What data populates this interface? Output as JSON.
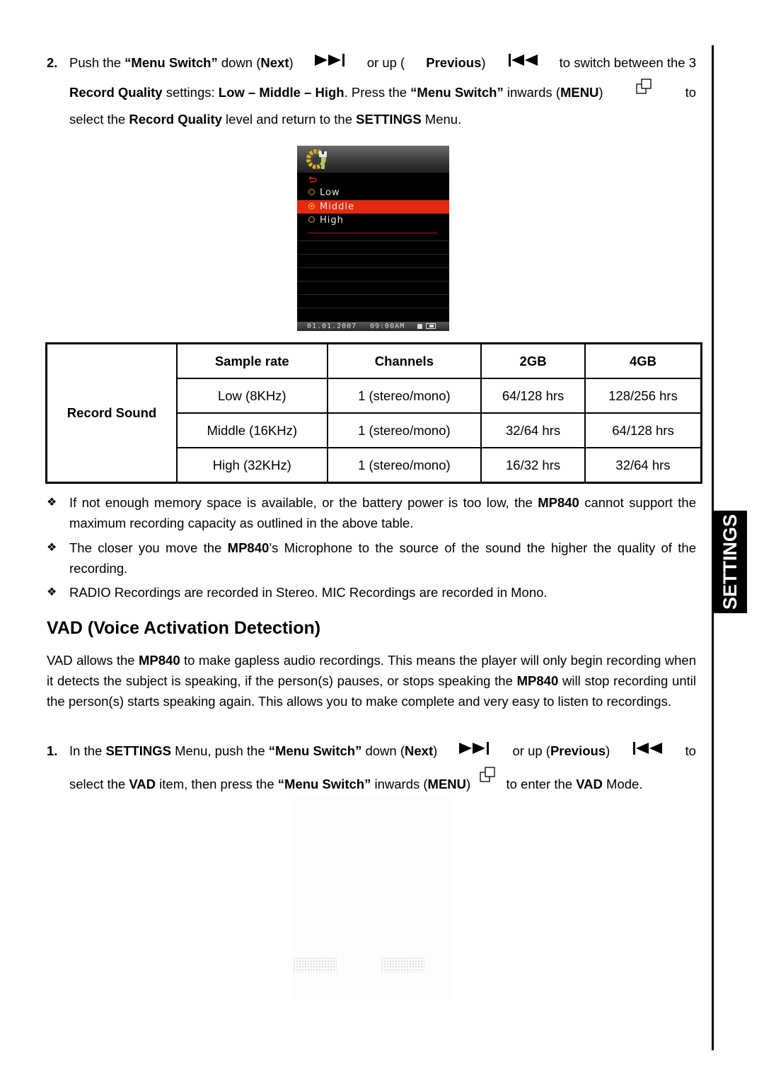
{
  "side_tab": {
    "label": "SETTINGS"
  },
  "step2": {
    "number": "2.",
    "line1": {
      "pre": "Push the ",
      "menu_switch": "“Menu Switch”",
      "down": " down (",
      "next": "Next",
      "close1": ")",
      "or_up": " or up (",
      "previous": "Previous",
      "close2": ")",
      "tail": " to switch between the 3"
    },
    "line2": {
      "record_quality": "Record Quality",
      "settings": " settings: ",
      "levels": "Low – Middle – High",
      "press": ". Press the ",
      "menu_switch": "“Menu Switch”",
      "inwards": " inwards (",
      "menu": "MENU",
      "close": ")",
      "to": "to"
    },
    "line3": {
      "pre": "select the ",
      "record_quality": "Record Quality",
      "mid": " level and return to the ",
      "settings": "SETTINGS",
      "tail": " Menu."
    }
  },
  "device_screen": {
    "header_icon": "settings-gear-wrench-icon",
    "back_icon": "back-arrow-icon",
    "options": [
      {
        "label": "Low",
        "selected": false
      },
      {
        "label": "Middle",
        "selected": true
      },
      {
        "label": "High",
        "selected": false
      }
    ],
    "status_date": "01.01.2007",
    "status_time": "09:00AM",
    "lock_icon": "lock-icon",
    "battery_icon": "battery-icon",
    "colors": {
      "selected_row": "#e22a10",
      "radio": "#d6a816",
      "background": "#000000"
    }
  },
  "table": {
    "row_header": "Record Sound",
    "columns": [
      "Sample rate",
      "Channels",
      "2GB",
      "4GB"
    ],
    "rows": [
      [
        "Low (8KHz)",
        "1 (stereo/mono)",
        "64/128 hrs",
        "128/256 hrs"
      ],
      [
        "Middle (16KHz)",
        "1 (stereo/mono)",
        "32/64 hrs",
        "64/128 hrs"
      ],
      [
        "High (32KHz)",
        "1 (stereo/mono)",
        "16/32 hrs",
        "32/64 hrs"
      ]
    ]
  },
  "notes": {
    "bullet_glyph": "❖",
    "n1": {
      "pre": "If not enough memory space is available, or the battery power is too low, the ",
      "model": "MP840",
      "tail": " cannot support the maximum recording capacity as outlined in the above table."
    },
    "n2": {
      "pre": "The closer you move the ",
      "model": "MP840",
      "tail": "’s Microphone to the source of the sound the higher the quality of the recording."
    },
    "n3": {
      "text": "RADIO Recordings are recorded in Stereo. MIC Recordings are recorded in Mono."
    }
  },
  "vad": {
    "heading": "VAD (Voice Activation Detection)",
    "p_pre": "VAD allows the ",
    "p_model1": "MP840",
    "p_mid": " to make gapless audio recordings. This means the player will only begin recording when it detects the subject is speaking, if the person(s) pauses, or stops speaking the ",
    "p_model2": "MP840",
    "p_tail": " will stop recording until the person(s) starts speaking again. This allows you to make complete and very easy to listen to recordings.",
    "step1": {
      "number": "1.",
      "line1": {
        "pre": "In the ",
        "settings": "SETTINGS",
        "menu_push": " Menu, push the ",
        "menu_switch": "“Menu Switch”",
        "down": " down (",
        "next": "Next",
        "close1": ")",
        "or_up": " or up (",
        "previous": "Previous",
        "close2": ")",
        "to": "to"
      },
      "line2": {
        "pre": "select the ",
        "vad": "VAD",
        "mid": " item, then press the ",
        "menu_switch": "“Menu Switch”",
        "inwards": " inwards (",
        "menu": "MENU",
        "close": ")",
        "enter": " to enter the ",
        "vad2": "VAD",
        "tail": " Mode."
      }
    }
  }
}
